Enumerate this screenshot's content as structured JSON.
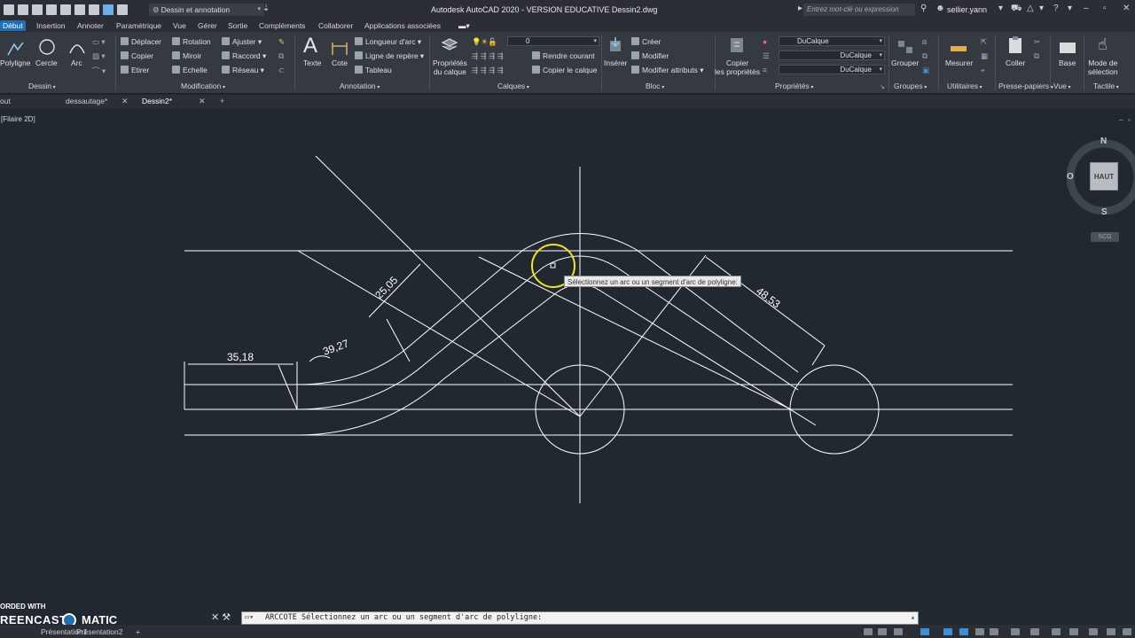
{
  "titlebar": {
    "workspace": "Dessin et annotation",
    "app_title": "Autodesk AutoCAD 2020 - VERSION EDUCATIVE    Dessin2.dwg",
    "search_placeholder": "Entrez mot-clé ou expression",
    "user": "sellier.yann"
  },
  "ribbon_tabs": [
    "Début",
    "Insertion",
    "Annoter",
    "Paramétrique",
    "Vue",
    "Gérer",
    "Sortie",
    "Compléments",
    "Collaborer",
    "Applications associées"
  ],
  "ribbon": {
    "dessin": {
      "label": "Dessin",
      "polyligne": "Polyligne",
      "cercle": "Cercle",
      "arc": "Arc"
    },
    "modification": {
      "label": "Modification",
      "items": [
        "Déplacer",
        "Rotation",
        "Ajuster",
        "Copier",
        "Miroir",
        "Raccord",
        "Etirer",
        "Echelle",
        "Réseau"
      ]
    },
    "annotation": {
      "label": "Annotation",
      "texte": "Texte",
      "cote": "Cote",
      "longueur_arc": "Longueur d'arc",
      "ligne_repere": "Ligne de repère",
      "tableau": "Tableau"
    },
    "calques": {
      "label": "Calques",
      "props": "Propriétés\ndu calque",
      "layer_value": "0",
      "rendre_courant": "Rendre courant",
      "copier_calque": "Copier le calque"
    },
    "bloc": {
      "label": "Bloc",
      "inserer": "Insérer",
      "creer": "Créer",
      "modifier": "Modifier",
      "modifier_attributs": "Modifier attributs"
    },
    "proprietes": {
      "label": "Propriétés",
      "copier": "Copier\nles propriétés",
      "color": "DuCalque",
      "linetype": "DuCalque",
      "lineweight": "DuCalque"
    },
    "groupes": {
      "label": "Groupes",
      "grouper": "Grouper"
    },
    "utilitaires": {
      "label": "Utilitaires",
      "mesurer": "Mesurer"
    },
    "presse_papiers": {
      "label": "Presse-papiers",
      "coller": "Coller"
    },
    "vue": {
      "label": "Vue",
      "base": "Base"
    },
    "tactile": {
      "label": "Tactile",
      "mode_selection": "Mode de\nsélection"
    }
  },
  "file_tabs": [
    "out",
    "dessautage*",
    "Dessin2*"
  ],
  "viewport": {
    "label": "[Filaire 2D]"
  },
  "viewcube": {
    "north": "N",
    "west": "O",
    "south": "S",
    "face": "HAUT",
    "ucs": "SCG"
  },
  "dimensions": {
    "d1": "35,18",
    "d2": "39,27",
    "d3": "25,05",
    "d4": "48,53"
  },
  "tooltip": "Sélectionnez un arc ou un segment d'arc de polyligne:",
  "command": {
    "name": "ARCCOTE",
    "prompt": "Sélectionnez un arc ou un segment d'arc de polyligne:"
  },
  "status_tabs": [
    "Présentation1",
    "Présentation2"
  ],
  "watermark": {
    "line1": "ORDED WITH",
    "line2a": "REENCAST",
    "line2b": "MATIC"
  },
  "colors": {
    "accent": "#1f6fb5",
    "drawing_bg": "#212830",
    "geometry": "#ffffff",
    "cursor": "#f2e51d"
  }
}
